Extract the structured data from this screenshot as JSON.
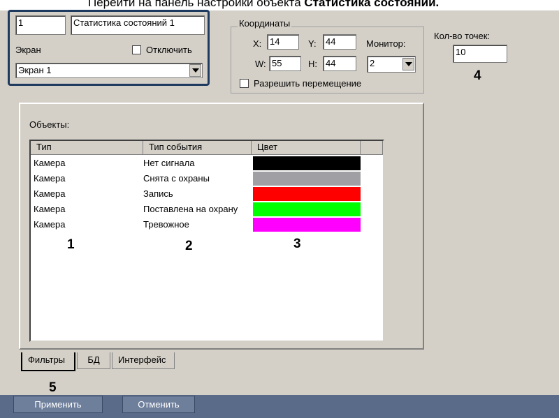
{
  "caption": {
    "prefix": "Перейти на панель настройки объекта ",
    "bold": "Статистика состояний."
  },
  "object": {
    "id": "1",
    "name": "Статистика состояний 1",
    "screen_label": "Экран",
    "disable_label": "Отключить",
    "screen_value": "Экран 1"
  },
  "coords": {
    "title": "Координаты",
    "x_label": "X:",
    "x_value": "14",
    "y_label": "Y:",
    "y_value": "44",
    "w_label": "W:",
    "w_value": "55",
    "h_label": "H:",
    "h_value": "44",
    "monitor_label": "Монитор:",
    "monitor_value": "2",
    "allow_move_label": "Разрешить перемещение"
  },
  "points": {
    "label": "Кол-во точек:",
    "value": "10"
  },
  "objects_label": "Объекты:",
  "table": {
    "headers": [
      "Тип",
      "Тип события",
      "Цвет"
    ],
    "rows": [
      {
        "type": "Камера",
        "event": "Нет сигнала",
        "color": "#000000"
      },
      {
        "type": "Камера",
        "event": "Снята с охраны",
        "color": "#a0a0a4"
      },
      {
        "type": "Камера",
        "event": "Запись",
        "color": "#ff0000"
      },
      {
        "type": "Камера",
        "event": "Поставлена на охрану",
        "color": "#00ff00"
      },
      {
        "type": "Камера",
        "event": "Тревожное",
        "color": "#ff00ff"
      }
    ]
  },
  "tabs": [
    "Фильтры",
    "БД",
    "Интерфейс"
  ],
  "buttons": {
    "apply": "Применить",
    "cancel": "Отменить"
  },
  "markers": {
    "m1": "1",
    "m2": "2",
    "m3": "3",
    "m4": "4",
    "m5": "5"
  }
}
